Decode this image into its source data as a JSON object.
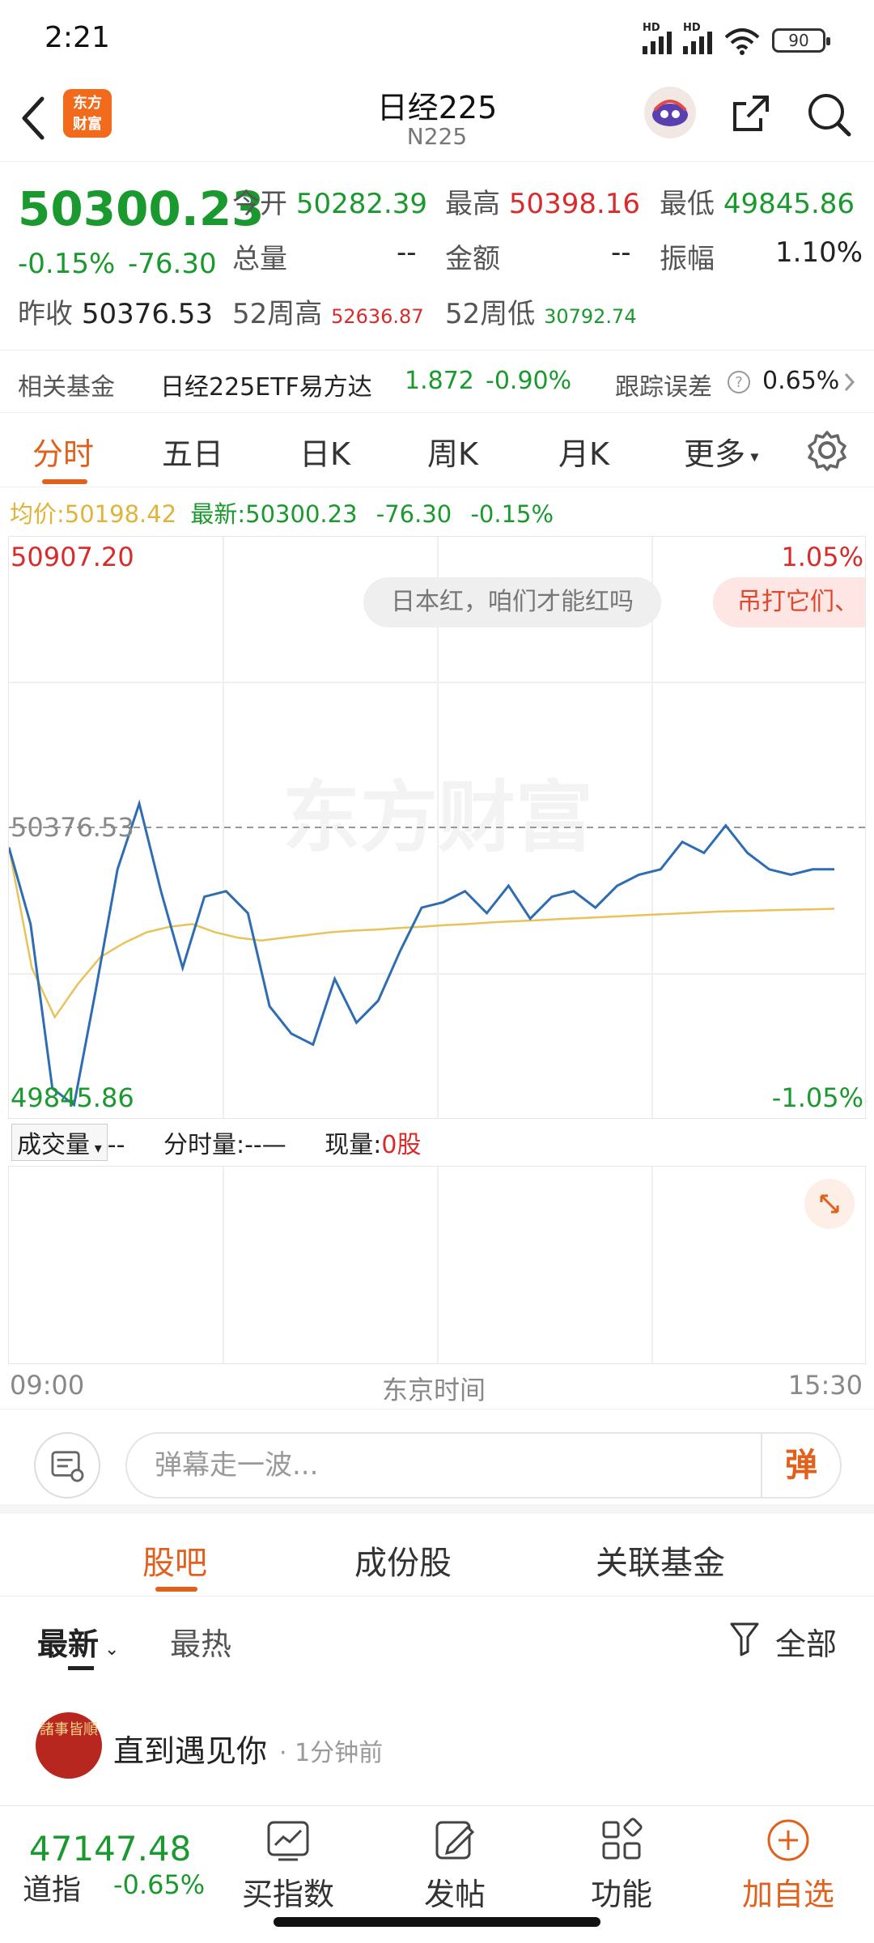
{
  "status_bar": {
    "time": "2:21",
    "battery": "90",
    "network_label": "HD"
  },
  "header": {
    "logo_line1": "东方",
    "logo_line2": "财富",
    "title": "日经225",
    "subtitle": "N225"
  },
  "quote": {
    "price": "50300.23",
    "change_pct": "-0.15%",
    "change": "-76.30",
    "open_label": "今开",
    "open": "50282.39",
    "high_label": "最高",
    "high": "50398.16",
    "low_label": "最低",
    "low": "49845.86",
    "volume_label": "总量",
    "volume": "--",
    "amount_label": "金额",
    "amount": "--",
    "amplitude_label": "振幅",
    "amplitude": "1.10%",
    "prev_close_label": "昨收",
    "prev_close": "50376.53",
    "w52_high_label": "52周高",
    "w52_high": "52636.87",
    "w52_low_label": "52周低",
    "w52_low": "30792.74"
  },
  "fund": {
    "label": "相关基金",
    "name": "日经225ETF易方达",
    "price": "1.872",
    "change": "-0.90%",
    "tracking_label": "跟踪误差",
    "tracking": "0.65%"
  },
  "tabs": [
    "分时",
    "五日",
    "日K",
    "周K",
    "月K",
    "更多"
  ],
  "avg_bar": {
    "avg_label": "均价:",
    "avg": "50198.42",
    "latest_label": "最新:",
    "latest": "50300.23",
    "change": "-76.30",
    "change_pct": "-0.15%"
  },
  "chart_labels": {
    "top_price": "50907.20",
    "top_pct": "1.05%",
    "ref_price": "50376.53",
    "bottom_price": "49845.86",
    "bottom_pct": "-1.05%",
    "watermark": "东方财富"
  },
  "danmaku": [
    "日本红，咱们才能红吗",
    "吊打它们、"
  ],
  "volume_bar": {
    "label": "成交量",
    "value": "--",
    "tick_label": "分时量:",
    "tick_value": "--—",
    "now_label": "现量:",
    "now_value": "0股"
  },
  "time_axis": {
    "start": "09:00",
    "middle": "东京时间",
    "end": "15:30"
  },
  "comment_input": {
    "placeholder": "弹幕走一波...",
    "button": "弹"
  },
  "sub_tabs": [
    "股吧",
    "成份股",
    "关联基金"
  ],
  "sort": {
    "latest": "最新",
    "hot": "最热",
    "filter": "全部"
  },
  "post": {
    "avatar_text": "諸事皆順",
    "user": "直到遇见你",
    "time": "· 1分钟前"
  },
  "bottom_bar": {
    "index_price": "47147.48",
    "index_name": "道指",
    "index_change": "-0.65%",
    "buy_index": "买指数",
    "post": "发帖",
    "functions": "功能",
    "add_watch": "加自选"
  },
  "chart_data": {
    "type": "line",
    "ylim": [
      49845.86,
      50907.2
    ],
    "reference": 50376.53,
    "x_range": [
      "09:00",
      "15:30"
    ],
    "series": [
      {
        "values": [
          50340,
          50200,
          49900,
          49870,
          50080,
          50300,
          50420,
          50260,
          50120,
          50250,
          50260,
          50220,
          50050,
          50000,
          49980,
          50100,
          50020,
          50060,
          50150,
          50230,
          50240,
          50260,
          50220,
          50270,
          50210,
          50250,
          50260,
          50230,
          50270,
          50290,
          50300,
          50350,
          50330,
          50380,
          50330,
          50300,
          50290,
          50300,
          50300
        ]
      },
      {
        "values": [
          50340,
          50120,
          50030,
          50090,
          50140,
          50165,
          50185,
          50195,
          50200,
          50185,
          50175,
          50170,
          50175,
          50180,
          50185,
          50188,
          50190,
          50193,
          50195,
          50198,
          50200,
          50203,
          50205,
          50207,
          50209,
          50211,
          50213,
          50215,
          50217,
          50219,
          50221,
          50223,
          50224,
          50225,
          50226,
          50227,
          50228
        ]
      }
    ]
  }
}
